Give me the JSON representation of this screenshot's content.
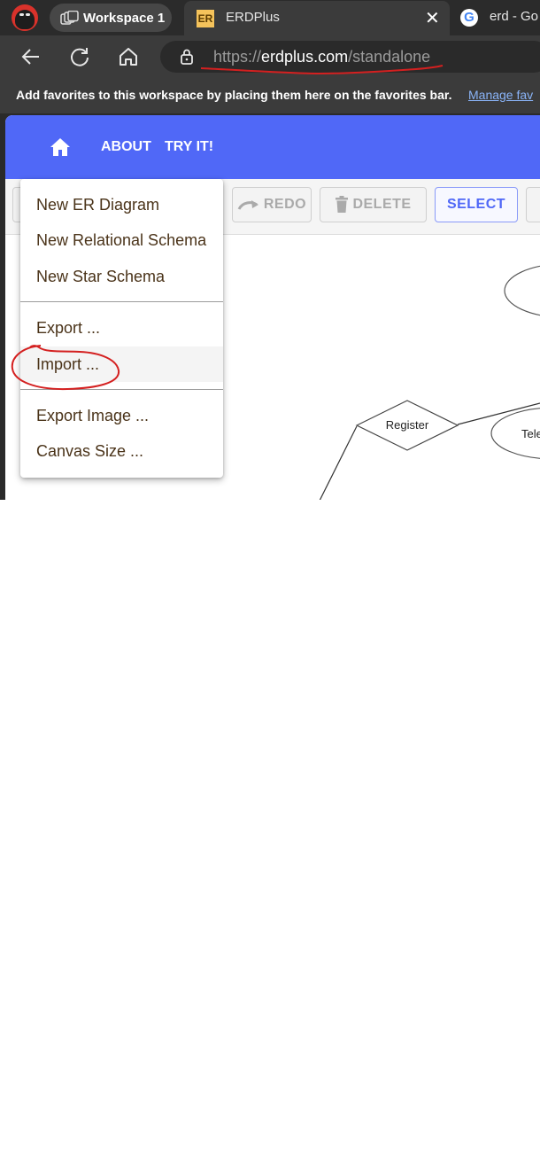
{
  "browser": {
    "workspace_label": "Workspace 1",
    "active_tab": {
      "favicon_text": "ER",
      "title": "ERDPlus",
      "close_glyph": "✕"
    },
    "inactive_tab": {
      "favicon_text": "G",
      "title": "erd - Go"
    },
    "url": {
      "scheme": "https://",
      "host": "erdplus.com",
      "path": "/standalone"
    },
    "favorites_bar": {
      "message": "Add favorites to this workspace by placing them here on the favorites bar.",
      "manage_link": "Manage fav"
    },
    "icons": [
      "profile-avatar",
      "workspaces-icon",
      "back-icon",
      "refresh-icon",
      "home-icon",
      "lock-icon",
      "google-icon"
    ]
  },
  "app": {
    "nav": {
      "about": "ABOUT",
      "try_it": "TRY IT!"
    },
    "toolbar": {
      "redo": "REDO",
      "delete": "DELETE",
      "select": "SELECT"
    },
    "menu": {
      "items": [
        "New ER Diagram",
        "New Relational Schema",
        "New Star Schema",
        "Export ...",
        "Import ...",
        "Export Image ...",
        "Canvas Size ..."
      ],
      "highlighted": "Import ..."
    },
    "diagram": {
      "relationship_label": "Register",
      "attribute_partial_label": "Tele"
    },
    "colors": {
      "navbar": "#5068f7",
      "select_accent": "#5068f7",
      "annotation": "#d42020",
      "menu_text": "#4a3319"
    }
  }
}
